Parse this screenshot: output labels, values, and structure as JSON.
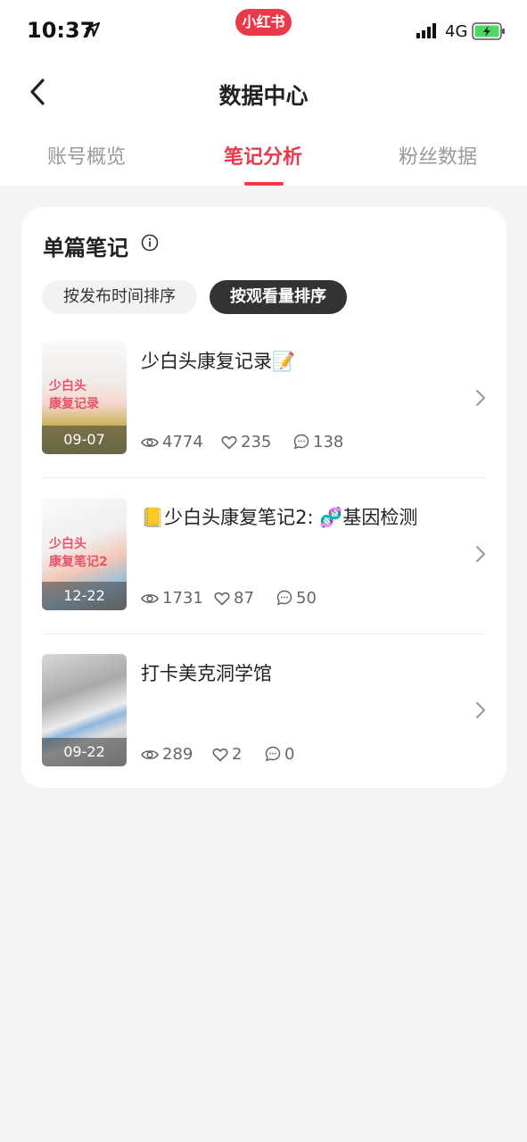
{
  "status_bar": {
    "time": "10:37",
    "app_badge": "小红书",
    "network": "4G"
  },
  "nav": {
    "title": "数据中心"
  },
  "tabs": [
    {
      "label": "账号概览",
      "active": false
    },
    {
      "label": "笔记分析",
      "active": true
    },
    {
      "label": "粉丝数据",
      "active": false
    }
  ],
  "section": {
    "title": "单篇笔记",
    "sort_options": [
      {
        "label": "按发布时间排序",
        "selected": false
      },
      {
        "label": "按观看量排序",
        "selected": true
      }
    ]
  },
  "notes": [
    {
      "title": "少白头康复记录📝",
      "date": "09-07",
      "views": "4774",
      "likes": "235",
      "comments": "138",
      "thumb_text": "少白头\n康复记录"
    },
    {
      "title": "📒少白头康复笔记2: 🧬基因检测",
      "date": "12-22",
      "views": "1731",
      "likes": "87",
      "comments": "50",
      "thumb_text": "少白头\n康复笔记2"
    },
    {
      "title": "打卡美克洞学馆",
      "date": "09-22",
      "views": "289",
      "likes": "2",
      "comments": "0",
      "thumb_text": ""
    }
  ],
  "colors": {
    "accent": "#ea3a4a",
    "chip_active_bg": "#333333",
    "background": "#f4f4f4"
  }
}
